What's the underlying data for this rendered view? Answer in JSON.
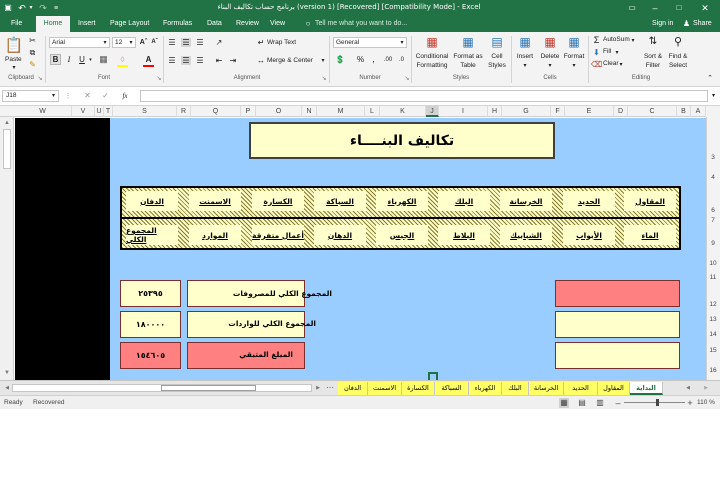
{
  "window": {
    "title": "برنامج حساب تكاليف البناء (version 1) [Recovered]  [Compatibility Mode] - Excel",
    "signin": "Sign in",
    "share": "Share",
    "tell_me": "Tell me what you want to do..."
  },
  "ribbon_tabs": [
    "File",
    "Home",
    "Insert",
    "Page Layout",
    "Formulas",
    "Data",
    "Review",
    "View"
  ],
  "ribbon": {
    "clipboard": {
      "paste": "Paste",
      "label": "Clipboard"
    },
    "font": {
      "name": "Arial",
      "size": "12",
      "bold": "B",
      "italic": "I",
      "underline": "U",
      "label": "Font"
    },
    "alignment": {
      "wrap": "Wrap Text",
      "merge": "Merge & Center",
      "label": "Alignment"
    },
    "number": {
      "format": "General",
      "percent": "%",
      "comma": ",",
      "dec_up": ".00",
      "dec_down": ".0",
      "label": "Number"
    },
    "styles": {
      "conditional": [
        "Conditional",
        "Formatting"
      ],
      "format_table": [
        "Format as",
        "Table"
      ],
      "cell_styles": [
        "Cell",
        "Styles"
      ],
      "label": "Styles"
    },
    "cells": {
      "insert": "Insert",
      "delete": "Delete",
      "format": "Format",
      "label": "Cells"
    },
    "editing": {
      "autosum": "AutoSum",
      "fill": "Fill",
      "clear": "Clear",
      "sort": [
        "Sort &",
        "Filter"
      ],
      "find": [
        "Find &",
        "Select"
      ],
      "label": "Editing"
    }
  },
  "formula_bar": {
    "name_box": "J18",
    "fx": "fx",
    "value": ""
  },
  "columns": [
    "W",
    "V",
    "U",
    "T",
    "S",
    "R",
    "Q",
    "P",
    "O",
    "N",
    "M",
    "L",
    "K",
    "J",
    "I",
    "H",
    "G",
    "F",
    "E",
    "D",
    "C",
    "B",
    "A"
  ],
  "rows": [
    "3",
    "4",
    "6",
    "7",
    "9",
    "10",
    "11",
    "12",
    "13",
    "14",
    "15",
    "16"
  ],
  "sheet": {
    "title": "تكاليف البنــــاء",
    "header_row1": [
      "المقاول",
      "الحديد",
      "الخرسانة",
      "البلك",
      "الكهرباء",
      "السباكة",
      "الكسارة",
      "الاسمنت",
      "الدفان"
    ],
    "header_row2": [
      "الماء",
      "الأبواب",
      "الشبابيك",
      "البلاط",
      "الجبس",
      "الدهان",
      "أعمال متفرقة",
      "الموارد",
      "المجموع الكلي"
    ],
    "summary": [
      {
        "label": "المجموع الكلي للمصروفات",
        "value": "٢٥٣٩٥"
      },
      {
        "label": "المجموع الكلي للواردات",
        "value": "١٨٠٠٠٠"
      },
      {
        "label": "المبلغ المتبقي",
        "value": "١٥٤٦٠٥"
      }
    ]
  },
  "sheet_tabs": [
    "البداية",
    "المقاول",
    "الحديد",
    "الخرسانة",
    "البلك",
    "الكهرباء",
    "السباكة",
    "الكسارة",
    "الاسمنت",
    "الدفان"
  ],
  "active_sheet_tab": "البداية",
  "status": {
    "ready": "Ready",
    "recovered": "Recovered",
    "zoom": "110 %"
  },
  "colors": {
    "excel_green": "#217346",
    "sheet_background": "#99ccff",
    "cell_yellow": "#ffffcc",
    "cell_pink": "#ff8080",
    "tab_yellow": "#ffff66"
  }
}
